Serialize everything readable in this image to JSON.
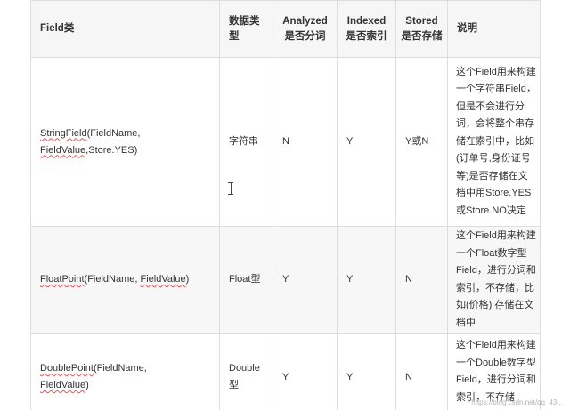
{
  "table": {
    "headers": {
      "field_class": "Field类",
      "data_type": "数据类型",
      "analyzed": "Analyzed 是否分词",
      "indexed": "Indexed 是否索引",
      "stored": "Stored 是否存储",
      "note": "说明"
    },
    "rows": [
      {
        "field_class_name": "StringField",
        "field_class_args_1": "(FieldName,",
        "field_class_args_2a": "FieldValue",
        "field_class_args_2b": ",Store.YES)",
        "data_type": "字符串",
        "analyzed": "N",
        "indexed": "Y",
        "stored": "Y或N",
        "note": "这个Field用来构建一个字符串Field，但是不会进行分词，会将整个串存储在索引中，比如(订单号,身份证号等)是否存储在文档中用Store.YES或Store.NO决定"
      },
      {
        "field_class_name": "FloatPoint",
        "field_class_args_1": "(FieldName, ",
        "field_class_args_2a": "FieldValue",
        "field_class_args_2b": ")",
        "data_type": "Float型",
        "analyzed": "Y",
        "indexed": "Y",
        "stored": "N",
        "note": "这个Field用来构建一个Float数字型Field，进行分词和索引，不存储，比如(价格) 存储在文档中"
      },
      {
        "field_class_name": "DoublePoint",
        "field_class_args_1": "(FieldName,",
        "field_class_args_2a": "FieldValue",
        "field_class_args_2b": ")",
        "data_type": "Double型",
        "analyzed": "Y",
        "indexed": "Y",
        "stored": "N",
        "note": "这个Field用来构建一个Double数字型Field，进行分词和索引，不存储"
      }
    ]
  },
  "watermark": "https://blog.csdn.net/qq_43..."
}
